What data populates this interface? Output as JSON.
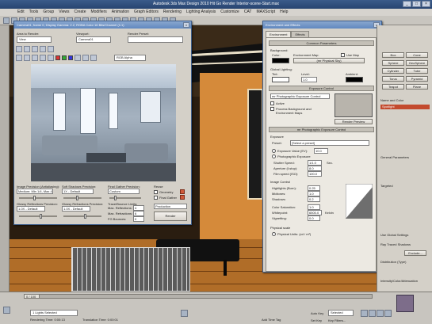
{
  "app": {
    "title": "Autodesk 3ds Max Design 2010   Hit Go Render    Interior-scene-Start.max",
    "window_buttons": [
      "_",
      "□",
      "×"
    ],
    "menu": [
      "Edit",
      "Tools",
      "Group",
      "Views",
      "Create",
      "Modifiers",
      "Animation",
      "Graph Editors",
      "Rendering",
      "Lighting Analysis",
      "Customize",
      "CAT",
      "MAXScript",
      "Help"
    ]
  },
  "render_window": {
    "title": "Camera01, frame 0, Display Gamma: 2.2, RGBA Color 16 Bits/Channel (1:1)",
    "area_to_render_label": "Area to Render:",
    "area_to_render_value": "View",
    "viewport_label": "Viewport:",
    "viewport_value": "Camera01",
    "render_preset_label": "Render Preset:",
    "render_preset_value": "",
    "channel_value": "RGB Alpha",
    "params": {
      "image_precision_label": "Image Precision (Antialiasing):",
      "image_precision_value": "Medium: Min 1/4, Max 4",
      "soft_shadows_label": "Soft Shadows Precision:",
      "soft_shadows_value": "1X - Default",
      "final_gather_label": "Final Gather Precision:",
      "final_gather_value": "Custom",
      "reuse_label": "Reuse",
      "geometry_label": "Geometry",
      "final_gather_check_label": "Final Gather",
      "glossy_refl_label": "Glossy Reflections Precision:",
      "glossy_refl_value": "1.0X - Default",
      "glossy_refr_label": "Glossy Refractions Precision:",
      "glossy_refr_value": "1.0X - Default",
      "trace_bounce_label": "Trace/Bounce Limits:",
      "max_reflections_label": "Max. Reflections:",
      "max_reflections_value": "4",
      "max_refractions_label": "Max. Refractions:",
      "max_refractions_value": "6",
      "fg_bounces_label": "FG Bounces:",
      "fg_bounces_value": "0",
      "production_value": "Production",
      "render_button": "Render"
    }
  },
  "env_dialog": {
    "title": "Environment and Effects",
    "tabs": [
      "Environment",
      "Effects"
    ],
    "common_params": "Common Parameters",
    "background_label": "Background:",
    "color_label": "Color:",
    "env_map_label": "Environment Map:",
    "use_map_label": "Use Map",
    "env_map_value": "(mr Physical Sky)",
    "global_lighting_label": "Global Lighting:",
    "tint_label": "Tint:",
    "level_label": "Level:",
    "level_value": "1.0",
    "ambient_label": "Ambient:",
    "exposure_control": "Exposure Control",
    "exposure_type": "mr Photographic Exposure Control",
    "active_label": "Active",
    "process_bg_label": "Process Background and Environment Maps",
    "render_preview_button": "Render Preview",
    "mr_photo_exposure": "mr Photographic Exposure Control",
    "exposure_group": "Exposure",
    "preset_label": "Preset:",
    "preset_value": "[Select a preset]",
    "exposure_value_label": "Exposure Value (EV):",
    "exposure_value": "10.0",
    "photographic_exposure_label": "Photographic Exposure",
    "shutter_speed_label": "Shutter Speed:",
    "shutter_speed_value": "1/1.0",
    "aperture_label": "Aperture (f-stop):",
    "aperture_value": "8.0",
    "film_speed_label": "Film speed (ISO):",
    "film_speed_value": "100.0",
    "sec_label": "Sec.",
    "image_control_group": "Image Control",
    "highlights_label": "Highlights (Burn):",
    "highlights_value": "0.25",
    "midtones_label": "Midtones:",
    "midtones_value": "1.0",
    "shadows_label": "Shadows:",
    "shadows_value": "0.2",
    "color_saturation_label": "Color Saturation:",
    "color_saturation_value": "1.0",
    "whitepoint_label": "Whitepoint:",
    "whitepoint_value": "6500.0",
    "kelvin_label": "Kelvin",
    "vignetting_label": "Vignetting:",
    "vignetting_value": "0.0",
    "physical_scale_group": "Physical scale",
    "physical_units_label": "Physical Units: (cd / m²)"
  },
  "command_panel": {
    "buttons": [
      "Box",
      "Cone",
      "Sphere",
      "GeoSphere",
      "Cylinder",
      "Tube",
      "Torus",
      "Pyramid",
      "Teapot",
      "Plane"
    ],
    "name_color": "Name and Color",
    "red_label": "Spotlight",
    "params_label": "General Parameters",
    "target_label": "Targeted",
    "use_global_label": "Use Global Settings",
    "ray_traced_label": "Ray Traced Shadows",
    "exclude_label": "Exclude...",
    "distribution_label": "Distribution (Type)",
    "intensity_label": "Intensity/Color/Attenuation"
  },
  "status": {
    "frame_counter": "0 / 100",
    "selection": "1 Lights Selected",
    "render_time_label": "Rendering Time: 0:00:13",
    "translation_time_label": "Translation Time: 0:00:01",
    "add_time_tag": "Add Time Tag",
    "set_key": "Set Key",
    "key_filters": "Key Filters...",
    "auto_key": "Auto Key",
    "selected": "Selected"
  },
  "colors": {
    "title_bar": "#274470",
    "dialog_title": "#6088bf",
    "panel_bg": "#d4d0c8",
    "floor": "#b06d28",
    "wall": "#d58a3a",
    "render_room": "#a5b2c0"
  }
}
